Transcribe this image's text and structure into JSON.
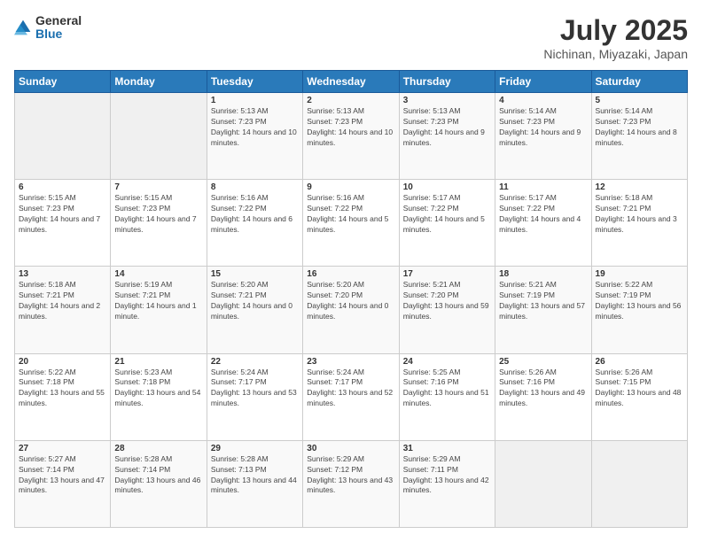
{
  "logo": {
    "general": "General",
    "blue": "Blue"
  },
  "title": {
    "month_year": "July 2025",
    "location": "Nichinan, Miyazaki, Japan"
  },
  "weekdays": [
    "Sunday",
    "Monday",
    "Tuesday",
    "Wednesday",
    "Thursday",
    "Friday",
    "Saturday"
  ],
  "weeks": [
    [
      {
        "day": "",
        "info": ""
      },
      {
        "day": "",
        "info": ""
      },
      {
        "day": "1",
        "info": "Sunrise: 5:13 AM\nSunset: 7:23 PM\nDaylight: 14 hours and 10 minutes."
      },
      {
        "day": "2",
        "info": "Sunrise: 5:13 AM\nSunset: 7:23 PM\nDaylight: 14 hours and 10 minutes."
      },
      {
        "day": "3",
        "info": "Sunrise: 5:13 AM\nSunset: 7:23 PM\nDaylight: 14 hours and 9 minutes."
      },
      {
        "day": "4",
        "info": "Sunrise: 5:14 AM\nSunset: 7:23 PM\nDaylight: 14 hours and 9 minutes."
      },
      {
        "day": "5",
        "info": "Sunrise: 5:14 AM\nSunset: 7:23 PM\nDaylight: 14 hours and 8 minutes."
      }
    ],
    [
      {
        "day": "6",
        "info": "Sunrise: 5:15 AM\nSunset: 7:23 PM\nDaylight: 14 hours and 7 minutes."
      },
      {
        "day": "7",
        "info": "Sunrise: 5:15 AM\nSunset: 7:23 PM\nDaylight: 14 hours and 7 minutes."
      },
      {
        "day": "8",
        "info": "Sunrise: 5:16 AM\nSunset: 7:22 PM\nDaylight: 14 hours and 6 minutes."
      },
      {
        "day": "9",
        "info": "Sunrise: 5:16 AM\nSunset: 7:22 PM\nDaylight: 14 hours and 5 minutes."
      },
      {
        "day": "10",
        "info": "Sunrise: 5:17 AM\nSunset: 7:22 PM\nDaylight: 14 hours and 5 minutes."
      },
      {
        "day": "11",
        "info": "Sunrise: 5:17 AM\nSunset: 7:22 PM\nDaylight: 14 hours and 4 minutes."
      },
      {
        "day": "12",
        "info": "Sunrise: 5:18 AM\nSunset: 7:21 PM\nDaylight: 14 hours and 3 minutes."
      }
    ],
    [
      {
        "day": "13",
        "info": "Sunrise: 5:18 AM\nSunset: 7:21 PM\nDaylight: 14 hours and 2 minutes."
      },
      {
        "day": "14",
        "info": "Sunrise: 5:19 AM\nSunset: 7:21 PM\nDaylight: 14 hours and 1 minute."
      },
      {
        "day": "15",
        "info": "Sunrise: 5:20 AM\nSunset: 7:21 PM\nDaylight: 14 hours and 0 minutes."
      },
      {
        "day": "16",
        "info": "Sunrise: 5:20 AM\nSunset: 7:20 PM\nDaylight: 14 hours and 0 minutes."
      },
      {
        "day": "17",
        "info": "Sunrise: 5:21 AM\nSunset: 7:20 PM\nDaylight: 13 hours and 59 minutes."
      },
      {
        "day": "18",
        "info": "Sunrise: 5:21 AM\nSunset: 7:19 PM\nDaylight: 13 hours and 57 minutes."
      },
      {
        "day": "19",
        "info": "Sunrise: 5:22 AM\nSunset: 7:19 PM\nDaylight: 13 hours and 56 minutes."
      }
    ],
    [
      {
        "day": "20",
        "info": "Sunrise: 5:22 AM\nSunset: 7:18 PM\nDaylight: 13 hours and 55 minutes."
      },
      {
        "day": "21",
        "info": "Sunrise: 5:23 AM\nSunset: 7:18 PM\nDaylight: 13 hours and 54 minutes."
      },
      {
        "day": "22",
        "info": "Sunrise: 5:24 AM\nSunset: 7:17 PM\nDaylight: 13 hours and 53 minutes."
      },
      {
        "day": "23",
        "info": "Sunrise: 5:24 AM\nSunset: 7:17 PM\nDaylight: 13 hours and 52 minutes."
      },
      {
        "day": "24",
        "info": "Sunrise: 5:25 AM\nSunset: 7:16 PM\nDaylight: 13 hours and 51 minutes."
      },
      {
        "day": "25",
        "info": "Sunrise: 5:26 AM\nSunset: 7:16 PM\nDaylight: 13 hours and 49 minutes."
      },
      {
        "day": "26",
        "info": "Sunrise: 5:26 AM\nSunset: 7:15 PM\nDaylight: 13 hours and 48 minutes."
      }
    ],
    [
      {
        "day": "27",
        "info": "Sunrise: 5:27 AM\nSunset: 7:14 PM\nDaylight: 13 hours and 47 minutes."
      },
      {
        "day": "28",
        "info": "Sunrise: 5:28 AM\nSunset: 7:14 PM\nDaylight: 13 hours and 46 minutes."
      },
      {
        "day": "29",
        "info": "Sunrise: 5:28 AM\nSunset: 7:13 PM\nDaylight: 13 hours and 44 minutes."
      },
      {
        "day": "30",
        "info": "Sunrise: 5:29 AM\nSunset: 7:12 PM\nDaylight: 13 hours and 43 minutes."
      },
      {
        "day": "31",
        "info": "Sunrise: 5:29 AM\nSunset: 7:11 PM\nDaylight: 13 hours and 42 minutes."
      },
      {
        "day": "",
        "info": ""
      },
      {
        "day": "",
        "info": ""
      }
    ]
  ]
}
